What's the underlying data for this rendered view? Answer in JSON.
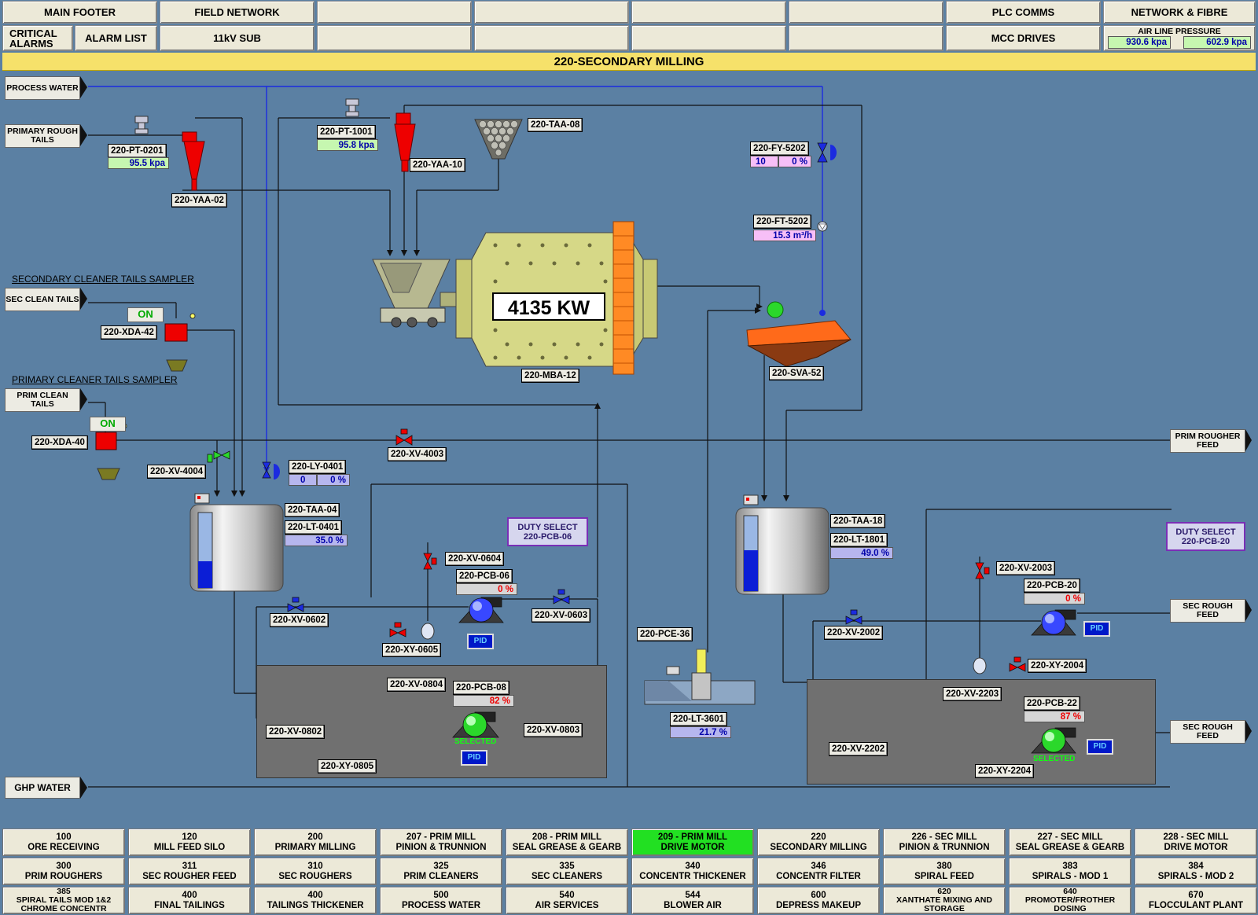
{
  "top_nav": {
    "main_footer": "MAIN FOOTER",
    "field_network": "FIELD NETWORK",
    "plc_comms": "PLC COMMS",
    "network_fibre": "NETWORK & FIBRE",
    "critical_alarms": "CRITICAL ALARMS",
    "alarm_list": "ALARM LIST",
    "sub_11kv": "11kV SUB",
    "mcc_drives": "MCC DRIVES",
    "air_line_pressure": "AIR LINE PRESSURE",
    "air_line_value_1": "930.6 kpa",
    "air_line_value_2": "602.9 kpa"
  },
  "screen_title": "220-SECONDARY MILLING",
  "sources": {
    "process_water": "PROCESS WATER",
    "primary_rough_tails": "PRIMARY ROUGH TAILS",
    "sec_clean_tails": "SEC CLEAN TAILS",
    "prim_clean_tails": "PRIM CLEAN TAILS",
    "ghp_water": "GHP WATER",
    "prim_rougher_feed": "PRIM ROUGHER FEED",
    "sec_rough_feed_1": "SEC ROUGH FEED",
    "sec_rough_feed_2": "SEC ROUGH FEED"
  },
  "captions": {
    "sec_sampler": "SECONDARY CLEANER TAILS SAMPLER",
    "prim_sampler": "PRIMARY CLEANER TAILS SAMPLER"
  },
  "on_status_1": "ON",
  "on_status_2": "ON",
  "mill_power": "4135 KW",
  "tags": {
    "pt0201": "220-PT-0201",
    "pt0201_val": "95.5 kpa",
    "yaa02": "220-YAA-02",
    "pt1001": "220-PT-1001",
    "pt1001_val": "95.8 kpa",
    "yaa10": "220-YAA-10",
    "taa08": "220-TAA-08",
    "fy5202": "220-FY-5202",
    "fy5202_a": "10",
    "fy5202_b": "0 %",
    "ft5202": "220-FT-5202",
    "ft5202_val": "15.3 m³/h",
    "mba12": "220-MBA-12",
    "sva52": "220-SVA-52",
    "xda42": "220-XDA-42",
    "xda40": "220-XDA-40",
    "xv4003": "220-XV-4003",
    "xv4004": "220-XV-4004",
    "ly0401": "220-LY-0401",
    "ly0401_a": "0",
    "ly0401_b": "0 %",
    "taa04": "220-TAA-04",
    "lt0401": "220-LT-0401",
    "lt0401_val": "35.0 %",
    "duty06_1": "DUTY SELECT",
    "duty06_2": "220-PCB-06",
    "xv0604": "220-XV-0604",
    "pcb06": "220-PCB-06",
    "pcb06_val": "0 %",
    "xv0602": "220-XV-0602",
    "xv0603": "220-XV-0603",
    "xy0605": "220-XY-0605",
    "pid1": "PID",
    "xv0804": "220-XV-0804",
    "pcb08": "220-PCB-08",
    "pcb08_val": "82 %",
    "xv0802": "220-XV-0802",
    "xv0803": "220-XV-0803",
    "selected1": "SELECTED",
    "pid2": "PID",
    "xy0805": "220-XY-0805",
    "pce36": "220-PCE-36",
    "lt3601": "220-LT-3601",
    "lt3601_val": "21.7 %",
    "taa18": "220-TAA-18",
    "lt1801": "220-LT-1801",
    "lt1801_val": "49.0 %",
    "duty20_1": "DUTY SELECT",
    "duty20_2": "220-PCB-20",
    "xv2003": "220-XV-2003",
    "pcb20": "220-PCB-20",
    "pcb20_val": "0 %",
    "xv2002": "220-XV-2002",
    "pid3": "PID",
    "xy2004": "220-XY-2004",
    "xv2203": "220-XV-2203",
    "pcb22": "220-PCB-22",
    "pcb22_val": "87 %",
    "xv2202": "220-XV-2202",
    "selected2": "SELECTED",
    "pid4": "PID",
    "xy2204": "220-XY-2204"
  },
  "bottom_nav": [
    [
      "100",
      "ORE RECEIVING"
    ],
    [
      "120",
      "MILL FEED SILO"
    ],
    [
      "200",
      "PRIMARY MILLING"
    ],
    [
      "207 - PRIM MILL",
      "PINION & TRUNNION"
    ],
    [
      "208 - PRIM MILL",
      "SEAL GREASE & GEARB"
    ],
    [
      "209 - PRIM MILL",
      "DRIVE MOTOR"
    ],
    [
      "220",
      "SECONDARY MILLING"
    ],
    [
      "226 - SEC MILL",
      "PINION & TRUNNION"
    ],
    [
      "227 - SEC MILL",
      "SEAL GREASE & GEARB"
    ],
    [
      "228 - SEC MILL",
      "DRIVE MOTOR"
    ],
    [
      "300",
      "PRIM ROUGHERS"
    ],
    [
      "311",
      "SEC ROUGHER FEED"
    ],
    [
      "310",
      "SEC ROUGHERS"
    ],
    [
      "325",
      "PRIM CLEANERS"
    ],
    [
      "335",
      "SEC CLEANERS"
    ],
    [
      "340",
      "CONCENTR THICKENER"
    ],
    [
      "346",
      "CONCENTR FILTER"
    ],
    [
      "380",
      "SPIRAL FEED"
    ],
    [
      "383",
      "SPIRALS - MOD 1"
    ],
    [
      "384",
      "SPIRALS - MOD 2"
    ],
    [
      "385",
      "SPIRAL TAILS MOD 1&2 CHROME CONCENTR"
    ],
    [
      "400",
      "FINAL TAILINGS"
    ],
    [
      "400",
      "TAILINGS THICKENER"
    ],
    [
      "500",
      "PROCESS WATER"
    ],
    [
      "540",
      "AIR SERVICES"
    ],
    [
      "544",
      "BLOWER AIR"
    ],
    [
      "600",
      "DEPRESS MAKEUP"
    ],
    [
      "620",
      "XANTHATE MIXING AND STORAGE"
    ],
    [
      "640",
      "PROMOTER/FROTHER DOSING"
    ],
    [
      "670",
      "FLOCCULANT PLANT"
    ]
  ],
  "colors": {
    "background": "#5b80a3",
    "title_bar": "#f6e16a",
    "active_nav": "#22e022"
  }
}
